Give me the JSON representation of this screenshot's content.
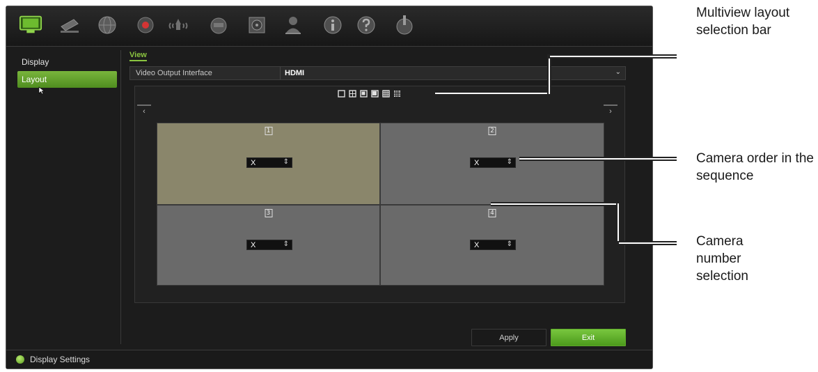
{
  "toolbar": {
    "icons": [
      {
        "name": "monitor-icon",
        "active": true
      },
      {
        "name": "camera-icon"
      },
      {
        "name": "network-icon"
      },
      {
        "name": "record-icon"
      },
      {
        "name": "alarm-icon"
      },
      {
        "name": "ptz-icon"
      },
      {
        "name": "hdd-icon"
      },
      {
        "name": "user-icon"
      },
      {
        "name": "info-icon"
      },
      {
        "name": "help-icon"
      },
      {
        "name": "power-icon"
      }
    ]
  },
  "sidebar": {
    "items": [
      {
        "label": "Display",
        "active": false
      },
      {
        "label": "Layout",
        "active": true
      }
    ]
  },
  "main": {
    "tab_label": "View",
    "video_output": {
      "label": "Video Output Interface",
      "value": "HDMI"
    },
    "layout_bar": [
      "1x1",
      "2x2",
      "1+5",
      "1+7",
      "3x3",
      "4x4"
    ],
    "nav_prev": "‹",
    "nav_next": "›",
    "cells": [
      {
        "number": "1",
        "camera": "X",
        "arrows": "⇕"
      },
      {
        "number": "2",
        "camera": "X",
        "arrows": "⇕"
      },
      {
        "number": "3",
        "camera": "X",
        "arrows": "⇕"
      },
      {
        "number": "4",
        "camera": "X",
        "arrows": "⇕"
      }
    ],
    "apply_label": "Apply",
    "exit_label": "Exit"
  },
  "status": {
    "text": "Display Settings"
  },
  "callouts": {
    "multiview": "Multiview layout selection bar",
    "camera_order": "Camera order in the sequence",
    "camera_number": "Camera number selection"
  },
  "colors": {
    "accent_green": "#79b53c",
    "selected_cell": "#8a866b",
    "cell": "#6a6a6a"
  }
}
